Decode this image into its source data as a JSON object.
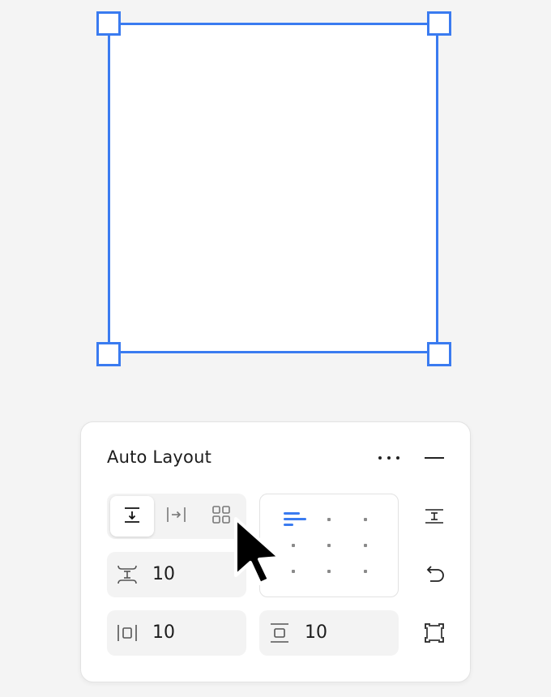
{
  "panel": {
    "title": "Auto Layout",
    "menu_icon": "more-icon",
    "collapse_icon": "minus-icon"
  },
  "direction": {
    "options": [
      {
        "name": "vertical",
        "icon": "arrow-down-icon",
        "selected": true
      },
      {
        "name": "horizontal",
        "icon": "arrow-right-icon",
        "selected": false
      },
      {
        "name": "wrap",
        "icon": "grid-icon",
        "selected": false
      }
    ]
  },
  "spacing": {
    "gap_value": "10",
    "horizontal_padding_value": "10",
    "vertical_padding_value": "10"
  },
  "alignment": {
    "selected": "top-left"
  },
  "side_actions": [
    {
      "icon": "distribute-spacing-icon"
    },
    {
      "icon": "wrap-return-icon"
    },
    {
      "icon": "frame-resize-icon"
    }
  ],
  "colors": {
    "accent": "#3a7bf0",
    "panel_bg": "#ffffff",
    "canvas_bg": "#f4f4f4"
  }
}
